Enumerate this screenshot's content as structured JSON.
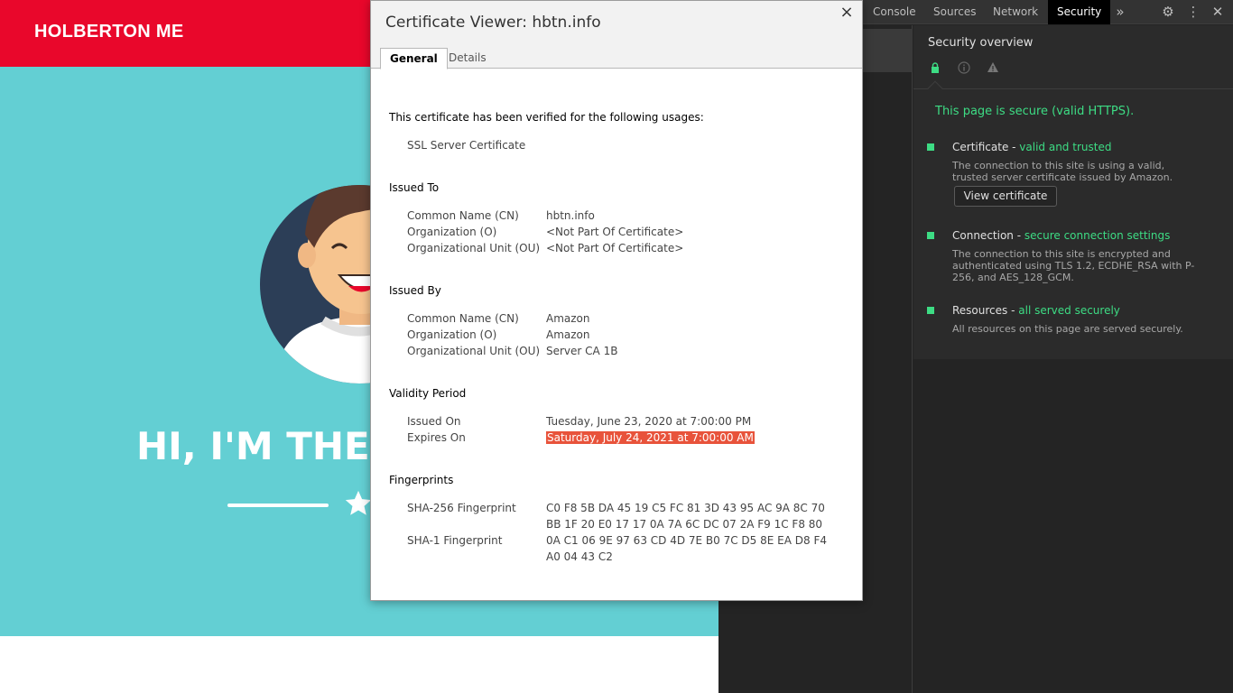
{
  "site": {
    "brand": "HOLBERTON ME",
    "hero_title": "HI, I'M THE"
  },
  "devtools": {
    "tabs": [
      {
        "label": "Console"
      },
      {
        "label": "Sources"
      },
      {
        "label": "Network"
      },
      {
        "label": "Security",
        "active": true
      }
    ],
    "more_icon": "»",
    "settings_icon": "⚙",
    "menu_icon": "⋮",
    "close_icon": "✕",
    "security": {
      "title": "Security overview",
      "headline": "This page is secure (valid HTTPS).",
      "items": [
        {
          "label": "Certificate - ",
          "status": "valid and trusted",
          "desc": "The connection to this site is using a valid, trusted server certificate issued by Amazon.",
          "button": "View certificate"
        },
        {
          "label": "Connection - ",
          "status": "secure connection settings",
          "desc": "The connection to this site is encrypted and authenticated using TLS 1.2, ECDHE_RSA with P-256, and AES_128_GCM."
        },
        {
          "label": "Resources - ",
          "status": "all served securely",
          "desc": "All resources on this page are served securely."
        }
      ]
    }
  },
  "cert": {
    "title": "Certificate Viewer: hbtn.info",
    "close": "×",
    "tabs": [
      "General",
      "Details"
    ],
    "verified_heading": "This certificate has been verified for the following usages:",
    "usage": "SSL Server Certificate",
    "issued_to": {
      "heading": "Issued To",
      "rows": [
        {
          "k": "Common Name (CN)",
          "v": "hbtn.info"
        },
        {
          "k": "Organization (O)",
          "v": "<Not Part Of Certificate>"
        },
        {
          "k": "Organizational Unit (OU)",
          "v": "<Not Part Of Certificate>"
        }
      ]
    },
    "issued_by": {
      "heading": "Issued By",
      "rows": [
        {
          "k": "Common Name (CN)",
          "v": "Amazon"
        },
        {
          "k": "Organization (O)",
          "v": "Amazon"
        },
        {
          "k": "Organizational Unit (OU)",
          "v": "Server CA 1B"
        }
      ]
    },
    "validity": {
      "heading": "Validity Period",
      "issued_on_label": "Issued On",
      "issued_on": "Tuesday, June 23, 2020 at 7:00:00 PM",
      "expires_on_label": "Expires On",
      "expires_on": "Saturday, July 24, 2021 at 7:00:00 AM"
    },
    "fingerprints": {
      "heading": "Fingerprints",
      "sha256_label": "SHA-256 Fingerprint",
      "sha256_line1": "C0 F8 5B DA 45 19 C5 FC 81 3D 43 95 AC 9A 8C 70",
      "sha256_line2": "BB 1F 20 E0 17 17 0A 7A 6C DC 07 2A F9 1C F8 80",
      "sha1_label": "SHA-1 Fingerprint",
      "sha1_line1": "0A C1 06 9E 97 63 CD 4D 7E B0 7C D5 8E EA D8 F4",
      "sha1_line2": "A0 04 43 C2"
    }
  }
}
